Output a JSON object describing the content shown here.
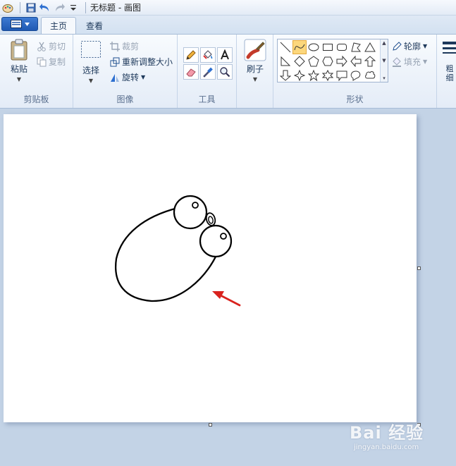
{
  "window": {
    "title": "无标题 - 画图"
  },
  "tabs": [
    {
      "label": "主页"
    },
    {
      "label": "查看"
    }
  ],
  "ribbon": {
    "clipboard": {
      "group_label": "剪贴板",
      "paste": "粘贴",
      "cut": "剪切",
      "copy": "复制"
    },
    "image": {
      "group_label": "图像",
      "select": "选择",
      "crop": "裁剪",
      "resize": "重新调整大小",
      "rotate": "旋转"
    },
    "tools": {
      "group_label": "工具"
    },
    "brushes": {
      "label": "刷子"
    },
    "shapes": {
      "group_label": "形状",
      "outline": "轮廓",
      "fill": "填充"
    },
    "size": {
      "label_line1": "粗",
      "label_line2": "细"
    }
  },
  "watermark": {
    "line1": "Bai 经验",
    "line2": "jingyan.baidu.com"
  },
  "colors": {
    "accent": "#1f59b3",
    "arrow": "#d9231e",
    "highlight": "#fcd77c"
  }
}
